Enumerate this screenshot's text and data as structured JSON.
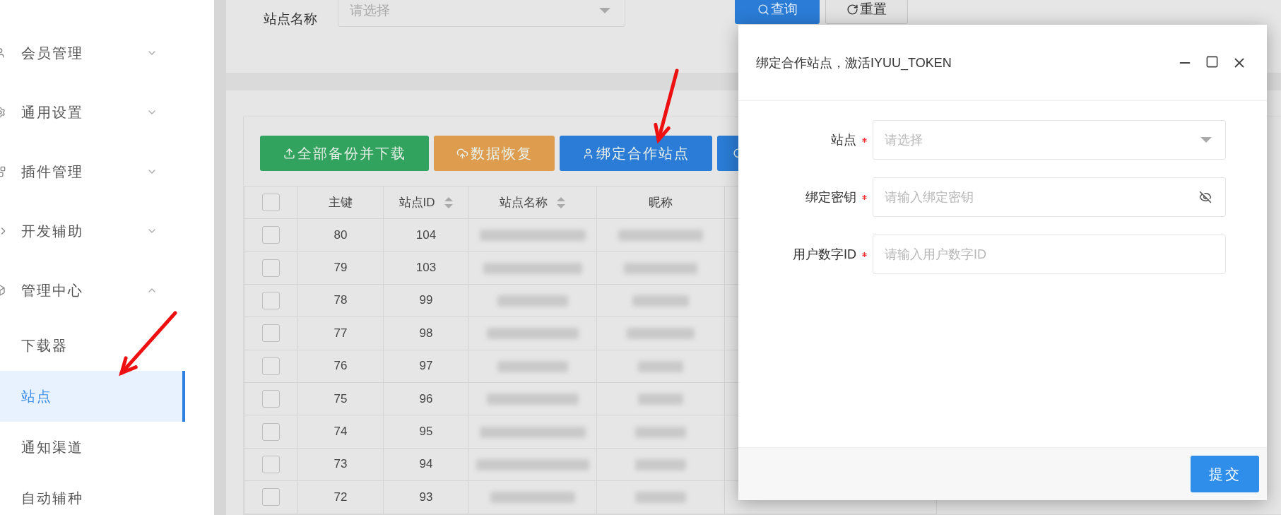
{
  "sidebar": {
    "items": [
      {
        "label": "会员管理",
        "expanded": false
      },
      {
        "label": "通用设置",
        "expanded": false
      },
      {
        "label": "插件管理",
        "expanded": false
      },
      {
        "label": "开发辅助",
        "expanded": false
      },
      {
        "label": "管理中心",
        "expanded": true,
        "children": [
          {
            "label": "下载器",
            "selected": false
          },
          {
            "label": "站点",
            "selected": true
          },
          {
            "label": "通知渠道",
            "selected": false
          },
          {
            "label": "自动辅种",
            "selected": false
          }
        ]
      }
    ]
  },
  "search": {
    "label": "站点名称",
    "placeholder": "请选择",
    "buttons": [
      {
        "label": "查询",
        "kind": "primary"
      },
      {
        "label": "重置",
        "kind": "default"
      }
    ]
  },
  "toolbar": {
    "buttons": [
      {
        "label": "全部备份并下载",
        "kind": "backup"
      },
      {
        "label": "数据恢复",
        "kind": "restore"
      },
      {
        "label": "绑定合作站点",
        "kind": "bind"
      },
      {
        "kind": "partial"
      }
    ]
  },
  "table": {
    "all_checked": false,
    "columns": [
      {
        "label": "主键",
        "sortable": false
      },
      {
        "label": "站点ID",
        "sortable": true
      },
      {
        "label": "站点名称",
        "sortable": true
      },
      {
        "label": "昵称",
        "sortable": false
      }
    ],
    "rows": [
      {
        "id": "80",
        "site_id": "104",
        "checked": false
      },
      {
        "id": "79",
        "site_id": "103",
        "checked": false
      },
      {
        "id": "78",
        "site_id": "99",
        "checked": false
      },
      {
        "id": "77",
        "site_id": "98",
        "checked": false
      },
      {
        "id": "76",
        "site_id": "97",
        "checked": false
      },
      {
        "id": "75",
        "site_id": "96",
        "checked": false
      },
      {
        "id": "74",
        "site_id": "95",
        "checked": false
      },
      {
        "id": "73",
        "site_id": "94",
        "checked": false
      },
      {
        "id": "72",
        "site_id": "93",
        "checked": false
      }
    ]
  },
  "dialog": {
    "title": "绑定合作站点，激活IYUU_TOKEN",
    "fields": [
      {
        "label": "站点",
        "required": true,
        "placeholder": "请选择",
        "kind": "select"
      },
      {
        "label": "绑定密钥",
        "required": true,
        "placeholder": "请输入绑定密钥",
        "kind": "password"
      },
      {
        "label": "用户数字ID",
        "required": true,
        "placeholder": "请输入用户数字ID",
        "kind": "text"
      }
    ],
    "submit": "提交"
  }
}
